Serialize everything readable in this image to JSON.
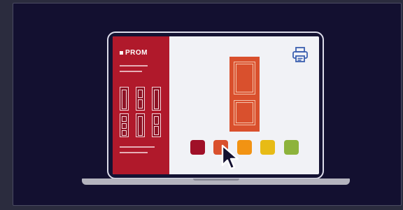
{
  "app": {
    "brand": "PROM"
  },
  "icons": {
    "print": "printer-icon",
    "cursor": "mouse-pointer-icon",
    "logo_mark": "square-logo-mark"
  },
  "colors": {
    "brand": "#b0192b",
    "selected_door": "#d9502d",
    "background": "#131030"
  },
  "swatches": [
    {
      "color": "#a01028"
    },
    {
      "color": "#d9502d"
    },
    {
      "color": "#f29313"
    },
    {
      "color": "#e7bb16"
    },
    {
      "color": "#8db33c"
    }
  ]
}
